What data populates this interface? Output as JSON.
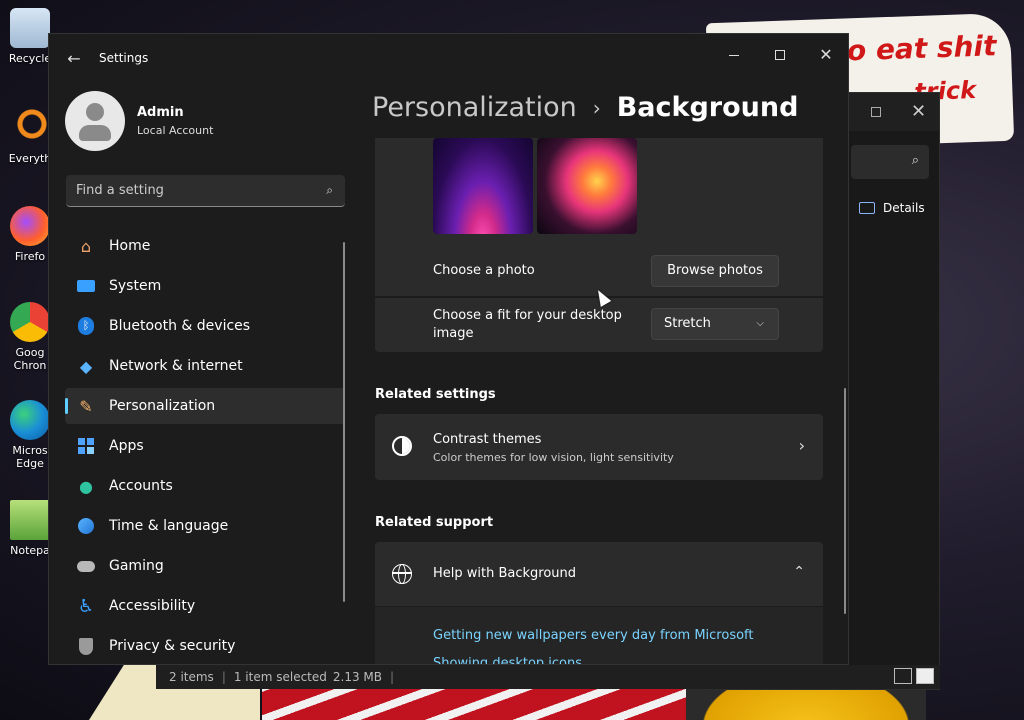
{
  "settings": {
    "title": "Settings",
    "profile": {
      "name": "Admin",
      "account_type": "Local Account"
    },
    "search": {
      "placeholder": "Find a setting"
    },
    "nav": [
      {
        "label": "Home",
        "icon": "home-icon",
        "active": false
      },
      {
        "label": "System",
        "icon": "system-icon",
        "active": false
      },
      {
        "label": "Bluetooth & devices",
        "icon": "bluetooth-icon",
        "active": false
      },
      {
        "label": "Network & internet",
        "icon": "network-icon",
        "active": false
      },
      {
        "label": "Personalization",
        "icon": "brush-icon",
        "active": true
      },
      {
        "label": "Apps",
        "icon": "apps-icon",
        "active": false
      },
      {
        "label": "Accounts",
        "icon": "accounts-icon",
        "active": false
      },
      {
        "label": "Time & language",
        "icon": "time-language-icon",
        "active": false
      },
      {
        "label": "Gaming",
        "icon": "gaming-icon",
        "active": false
      },
      {
        "label": "Accessibility",
        "icon": "accessibility-icon",
        "active": false
      },
      {
        "label": "Privacy & security",
        "icon": "shield-icon",
        "active": false
      }
    ],
    "breadcrumb": {
      "parent": "Personalization",
      "current": "Background"
    },
    "background": {
      "choose_photo_label": "Choose a photo",
      "browse_photos_button": "Browse photos",
      "fit_label": "Choose a fit for your desktop image",
      "fit_value": "Stretch"
    },
    "related_settings": {
      "title": "Related settings",
      "contrast_themes": {
        "title": "Contrast themes",
        "subtitle": "Color themes for low vision, light sensitivity"
      }
    },
    "related_support": {
      "title": "Related support",
      "help_title": "Help with Background",
      "links": [
        "Getting new wallpapers every day from Microsoft",
        "Showing desktop icons"
      ]
    }
  },
  "explorer": {
    "details_label": "Details",
    "status": {
      "items": "2 items",
      "selected": "1 item selected",
      "size": "2.13 MB"
    }
  },
  "desktop": {
    "icons": [
      "Recycle",
      "Everyth",
      "Firefo",
      "Goog Chron",
      "Micros Edge",
      "Notepa"
    ],
    "wallpaper_text": [
      "o eat shit",
      "trick"
    ]
  },
  "colors": {
    "accent": "#60cdff",
    "link": "#7ad3ff",
    "window_bg": "#1c1c1c",
    "card_bg": "#2b2b2b"
  }
}
